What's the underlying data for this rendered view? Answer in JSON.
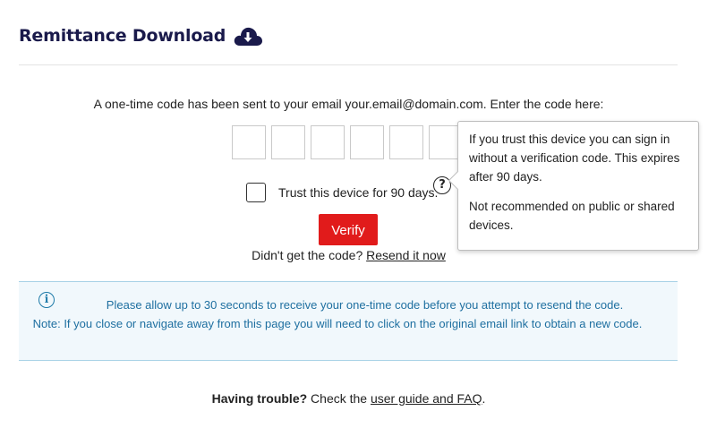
{
  "header": {
    "title": "Remittance Download",
    "icon": "cloud-download-icon",
    "accent_color": "#1a1a4b"
  },
  "verification": {
    "prompt": "A one-time code has been sent to your email your.email@domain.com. Enter the code here:",
    "code_length": 6,
    "trust_label": "Trust this device for 90 days.",
    "verify_label": "Verify",
    "verify_color": "#e11b1b",
    "resend_prefix": "Didn't get the code? ",
    "resend_link": "Resend it now"
  },
  "tooltip": {
    "paragraph1": "If you trust this device you can sign in without a verification code. This expires after 90 days.",
    "paragraph2": "Not recommended on public or shared devices."
  },
  "info": {
    "icon": "info-icon",
    "line1": "Please allow up to 30 seconds to receive your one-time code before you attempt to resend the code.",
    "line2": "Note: If you close or navigate away from this page you will need to click on the original email link to obtain a new code."
  },
  "footer": {
    "trouble_strong": "Having trouble?",
    "trouble_text": " Check the ",
    "trouble_link": "user guide and FAQ",
    "trouble_end": "."
  }
}
